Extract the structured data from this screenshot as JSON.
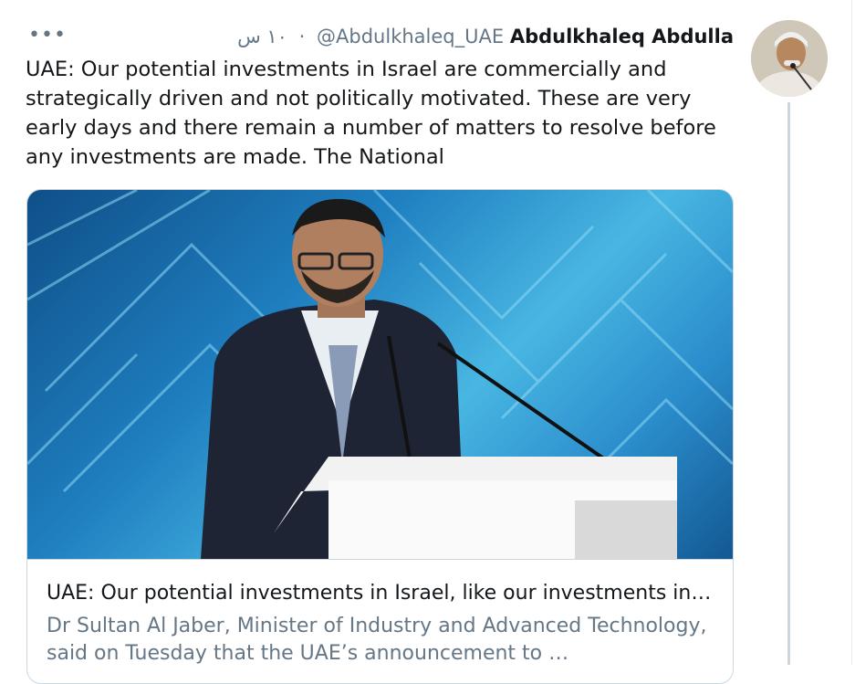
{
  "tweet": {
    "more_label": "•••",
    "display_name": "Abdulkhaleq Abdulla",
    "handle": "@Abdulkhaleq_UAE",
    "separator": "·",
    "time": "١٠ س",
    "text": "UAE: Our potential investments in Israel are commercially and strategically driven and not politically motivated. These are very early days and there remain a number of matters to resolve before any investments are made. The National",
    "card": {
      "title": "UAE: Our potential investments in Israel, like our investments in…",
      "description": "Dr Sultan Al Jaber, Minister of Industry and Advanced Technology, said on Tuesday that the UAE’s announcement to …"
    }
  },
  "icons": {
    "more": "more-options-icon",
    "avatar": "avatar"
  }
}
